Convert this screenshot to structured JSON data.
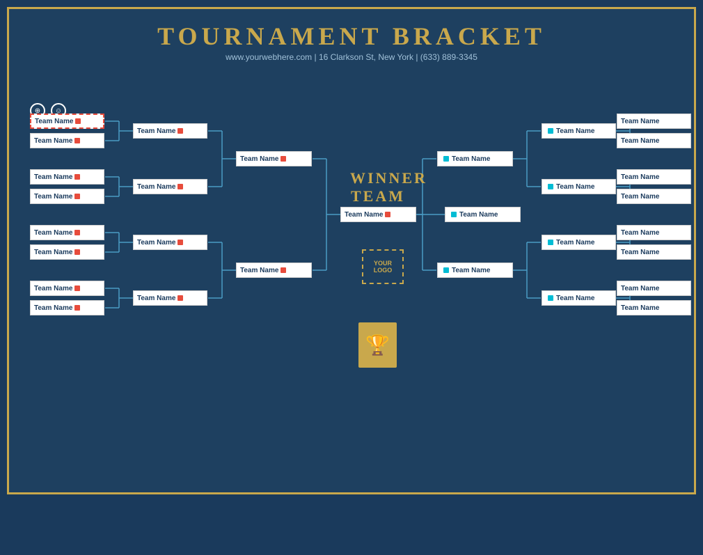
{
  "header": {
    "title": "TOURNAMENT BRACKET",
    "subtitle": "www.yourwebhere.com | 16 Clarkson St, New York | (633) 889-3345"
  },
  "winner": {
    "line1": "WINNER",
    "line2": "TEAM"
  },
  "logo": {
    "text": "YOUR\nLOGO"
  },
  "teams": {
    "left_r1": [
      "Team Name",
      "Team Name",
      "Team Name",
      "Team Name",
      "Team Name",
      "Team Name",
      "Team Name",
      "Team Name"
    ],
    "left_r2": [
      "Team Name",
      "Team Name",
      "Team Name",
      "Team Name"
    ],
    "left_r3": [
      "Team Name",
      "Team Name"
    ],
    "left_r4": [
      "Team Name"
    ],
    "right_r1": [
      "Team Name",
      "Team Name",
      "Team Name",
      "Team Name",
      "Team Name",
      "Team Name",
      "Team Name",
      "Team Name"
    ],
    "right_r2": [
      "Team Name",
      "Team Name",
      "Team Name",
      "Team Name"
    ],
    "right_r3": [
      "Team Name",
      "Team Name"
    ],
    "right_r4": [
      "Team Name"
    ]
  },
  "selected_team": "Team Name"
}
